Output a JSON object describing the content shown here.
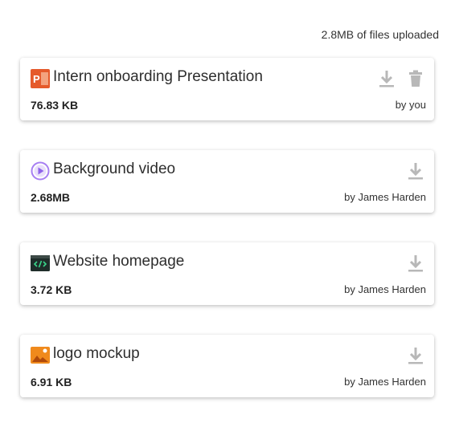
{
  "summary": "2.8MB of files uploaded",
  "files": [
    {
      "name": "Intern onboarding Presentation",
      "size": "76.83 KB",
      "owner": "by you",
      "icon": "powerpoint-icon",
      "can_delete": true
    },
    {
      "name": "Background video",
      "size": "2.68MB",
      "owner": "by James Harden",
      "icon": "video-icon",
      "can_delete": false
    },
    {
      "name": "Website homepage",
      "size": "3.72 KB",
      "owner": "by James Harden",
      "icon": "code-icon",
      "can_delete": false
    },
    {
      "name": "logo mockup",
      "size": "6.91 KB",
      "owner": "by James Harden",
      "icon": "image-icon",
      "can_delete": false
    }
  ],
  "colors": {
    "powerpoint": "#e55a2b",
    "video": "#a77ff2",
    "code_bg": "#1f2d2a",
    "code_fg": "#3ad58a",
    "image": "#f08a1c",
    "action_icon": "#b8b8b8"
  }
}
